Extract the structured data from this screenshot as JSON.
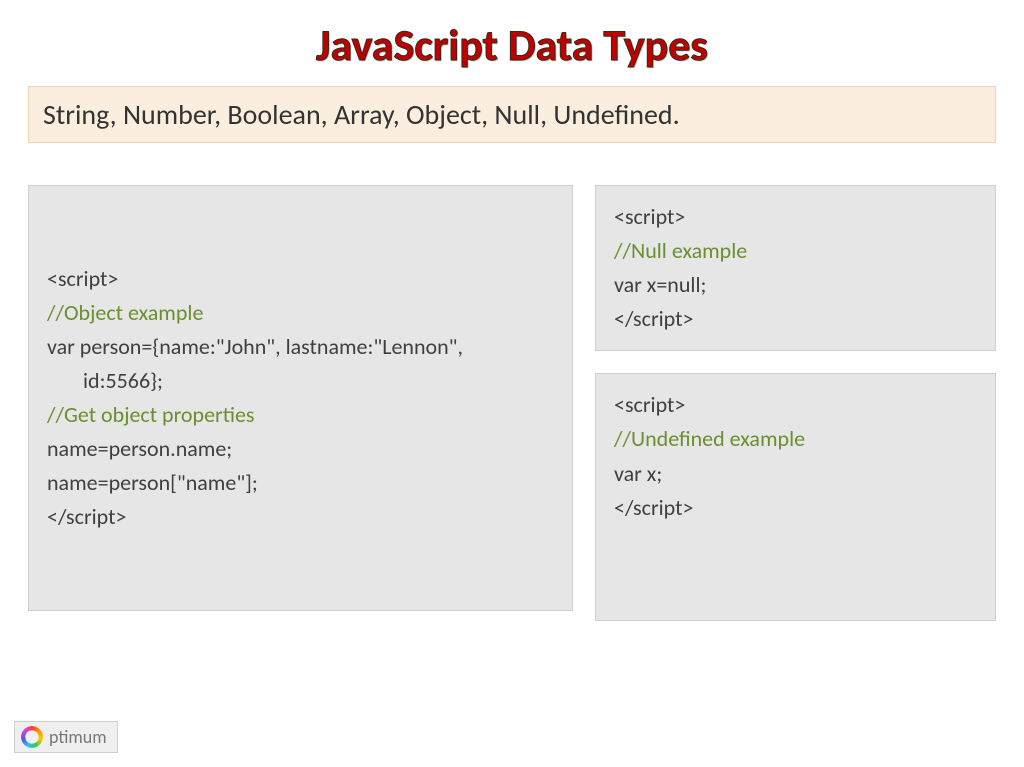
{
  "title": "JavaScript Data Types",
  "subtitle": "String, Number, Boolean, Array, Object, Null, Undefined.",
  "code_boxes": {
    "object_example": {
      "l1": "<script>",
      "l2": "//Object example",
      "l3a": "var person={name:\"John\", lastname:\"Lennon\",",
      "l3b": "id:5566};",
      "l4": "//Get object properties",
      "l5": "name=person.name;",
      "l6": "name=person[\"name\"];",
      "l7": "</script>"
    },
    "null_example": {
      "l1": "<script>",
      "l2": "//Null example",
      "l3": "var x=null;",
      "l4": "</script>"
    },
    "undefined_example": {
      "l1": "<script>",
      "l2": "//Undefined example",
      "l3": "var x;",
      "l4": "</script>"
    }
  },
  "logo_text": "ptimum"
}
